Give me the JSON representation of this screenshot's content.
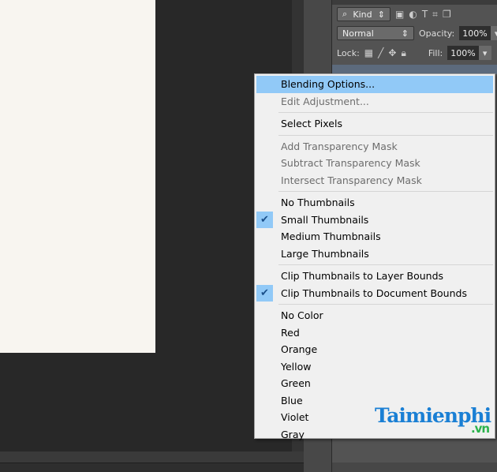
{
  "panel": {
    "kind": "Kind",
    "blend_mode": "Normal",
    "opacity_label": "Opacity:",
    "opacity": "100%",
    "lock_label": "Lock:",
    "fill_label": "Fill:",
    "fill": "100%"
  },
  "menu": {
    "items": [
      {
        "label": "Blending Options...",
        "state": "highlighted"
      },
      {
        "label": "Edit Adjustment...",
        "state": "disabled"
      },
      {
        "sep": true
      },
      {
        "label": "Select Pixels"
      },
      {
        "sep": true
      },
      {
        "label": "Add Transparency Mask",
        "state": "disabled"
      },
      {
        "label": "Subtract Transparency Mask",
        "state": "disabled"
      },
      {
        "label": "Intersect Transparency Mask",
        "state": "disabled"
      },
      {
        "sep": true
      },
      {
        "label": "No Thumbnails"
      },
      {
        "label": "Small Thumbnails",
        "checked": true
      },
      {
        "label": "Medium Thumbnails"
      },
      {
        "label": "Large Thumbnails"
      },
      {
        "sep": true
      },
      {
        "label": "Clip Thumbnails to Layer Bounds"
      },
      {
        "label": "Clip Thumbnails to Document Bounds",
        "checked": true
      },
      {
        "sep": true
      },
      {
        "label": "No Color"
      },
      {
        "label": "Red"
      },
      {
        "label": "Orange"
      },
      {
        "label": "Yellow"
      },
      {
        "label": "Green"
      },
      {
        "label": "Blue"
      },
      {
        "label": "Violet"
      },
      {
        "label": "Gray"
      }
    ]
  },
  "watermark": {
    "text": "Taimienphi",
    "suffix": ".vn"
  },
  "colors": {
    "highlight": "#91c9f7",
    "menu_bg": "#f0f0f0",
    "panel_bg": "#535353"
  }
}
